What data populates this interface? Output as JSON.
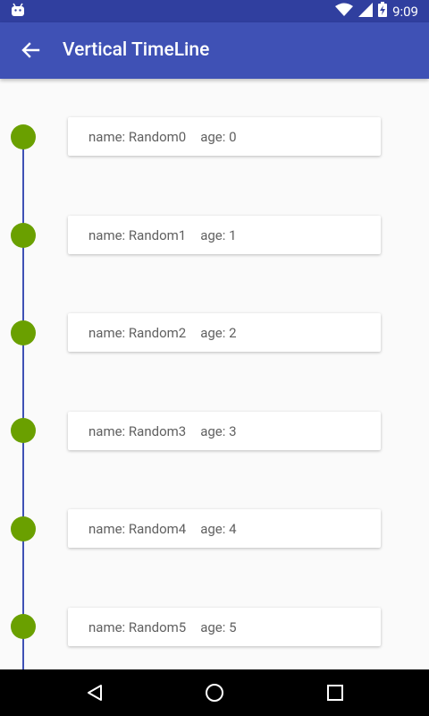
{
  "status_bar": {
    "time": "9:09"
  },
  "app_bar": {
    "title": "Vertical TimeLine"
  },
  "timeline": {
    "items": [
      {
        "name_label": "name:",
        "name_value": "Random0",
        "age_label": "age:",
        "age_value": "0"
      },
      {
        "name_label": "name:",
        "name_value": "Random1",
        "age_label": "age:",
        "age_value": "1"
      },
      {
        "name_label": "name:",
        "name_value": "Random2",
        "age_label": "age:",
        "age_value": "2"
      },
      {
        "name_label": "name:",
        "name_value": "Random3",
        "age_label": "age:",
        "age_value": "3"
      },
      {
        "name_label": "name:",
        "name_value": "Random4",
        "age_label": "age:",
        "age_value": "4"
      },
      {
        "name_label": "name:",
        "name_value": "Random5",
        "age_label": "age:",
        "age_value": "5"
      }
    ]
  },
  "colors": {
    "primary": "#3f51b5",
    "primary_dark": "#303f9f",
    "node": "#6aa000",
    "line": "#3f51b5"
  },
  "icons": {
    "back": "arrow-left-icon",
    "android": "android-icon",
    "wifi": "wifi-icon",
    "signal": "signal-icon",
    "battery": "battery-charging-icon",
    "nav_back": "nav-back-icon",
    "nav_home": "nav-home-icon",
    "nav_recents": "nav-recents-icon"
  }
}
